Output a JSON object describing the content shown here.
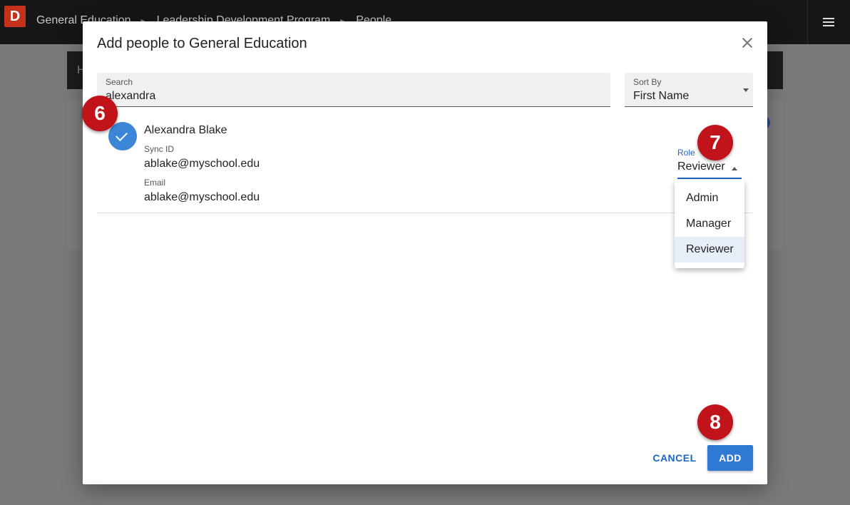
{
  "app": {
    "logo_letter": "D",
    "breadcrumbs": [
      "General Education",
      "Leadership Development Program",
      "People"
    ],
    "breadcrumb_separator": "▸",
    "panel_initial": "H"
  },
  "dialog": {
    "title": "Add people to General Education",
    "search": {
      "label": "Search",
      "value": "alexandra"
    },
    "sort": {
      "label": "Sort By",
      "value": "First Name"
    },
    "person": {
      "name": "Alexandra Blake",
      "sync_id_label": "Sync ID",
      "sync_id": "ablake@myschool.edu",
      "email_label": "Email",
      "email": "ablake@myschool.edu",
      "selected": true,
      "role_label": "Role",
      "role": "Reviewer"
    },
    "role_options": [
      {
        "label": "Admin"
      },
      {
        "label": "Manager"
      },
      {
        "label": "Reviewer",
        "selected": true
      }
    ],
    "cancel_label": "CANCEL",
    "add_label": "ADD"
  },
  "callouts": [
    "6",
    "7",
    "8"
  ],
  "colors": {
    "accent": "#2f78d3",
    "callout": "#c0141a",
    "logo": "#c4321c"
  }
}
